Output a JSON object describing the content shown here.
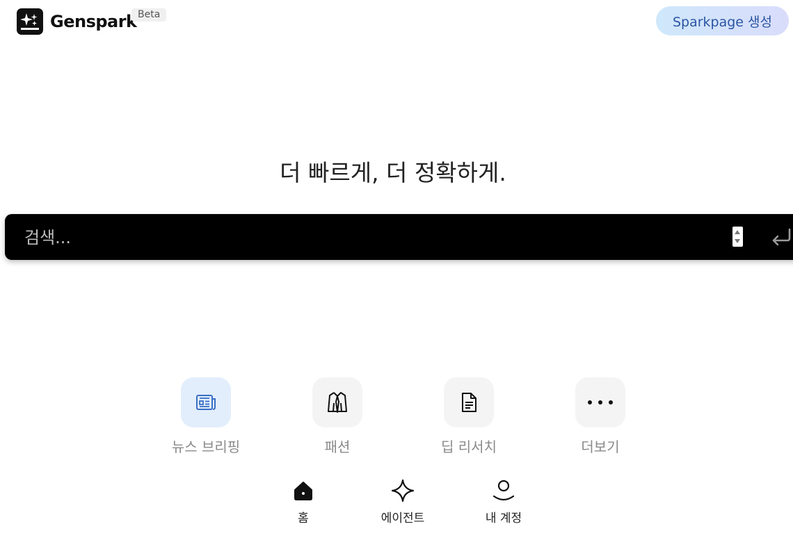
{
  "header": {
    "brand": "Genspark",
    "badge": "Beta",
    "sparkpage_button": "Sparkpage 생성"
  },
  "main": {
    "tagline": "더 빠르게, 더 정확하게.",
    "search": {
      "placeholder": "검색...",
      "value": ""
    }
  },
  "quick_actions": [
    {
      "label": "뉴스 브리핑",
      "icon": "newspaper-icon"
    },
    {
      "label": "패션",
      "icon": "jacket-icon"
    },
    {
      "label": "딥 리서치",
      "icon": "document-icon"
    },
    {
      "label": "더보기",
      "icon": "more-dots-icon"
    }
  ],
  "bottom_nav": [
    {
      "label": "홈",
      "icon": "home-icon"
    },
    {
      "label": "에이전트",
      "icon": "sparkle-icon"
    },
    {
      "label": "내 계정",
      "icon": "user-icon"
    }
  ],
  "colors": {
    "accent_text": "#2b55a3",
    "search_bg": "#000000",
    "news_tile": "#e2eefc",
    "tile_bg": "#f4f4f4"
  }
}
